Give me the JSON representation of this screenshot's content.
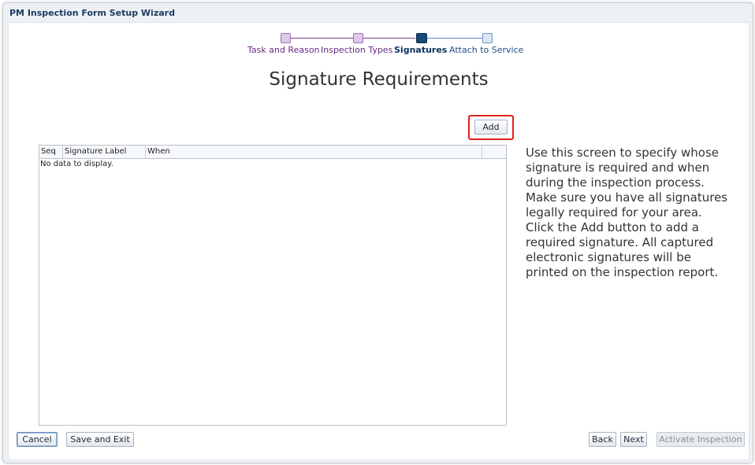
{
  "window": {
    "title": "PM Inspection Form Setup Wizard"
  },
  "train": {
    "steps": [
      {
        "label": "Task and Reason",
        "state": "done"
      },
      {
        "label": "Inspection Types",
        "state": "done"
      },
      {
        "label": "Signatures",
        "state": "current"
      },
      {
        "label": "Attach to Service",
        "state": "todo"
      }
    ]
  },
  "page": {
    "heading": "Signature Requirements"
  },
  "toolbar": {
    "add_label": "Add"
  },
  "table": {
    "columns": [
      "Seq",
      "Signature Label",
      "When"
    ],
    "empty_text": "No data to display."
  },
  "help": {
    "text": "Use this screen to specify whose signature is required and when during the inspection process. Make sure you have all signatures legally required for your area. Click the Add button to add a required signature. All captured electronic signatures will be printed on the inspection report."
  },
  "footer": {
    "cancel_label": "Cancel",
    "save_exit_label": "Save and Exit",
    "back_label": "Back",
    "next_label": "Next",
    "activate_label": "Activate Inspection"
  },
  "colors": {
    "accent": "#154a7a",
    "completed_step": "#6c2a86",
    "highlight_border": "#e0211d"
  }
}
